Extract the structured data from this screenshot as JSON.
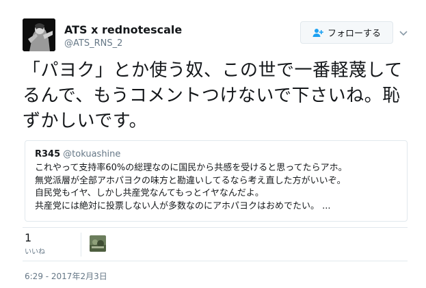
{
  "author": {
    "name": "ATS x rednotescale",
    "handle": "@ATS_RNS_2"
  },
  "follow_button": {
    "label": "フォローする",
    "icon": "add-user-icon"
  },
  "tweet_text": "「パヨク」とか使う奴、この世で一番軽蔑してるんで、もうコメントつけないで下さいね。恥ずかしいです。",
  "quoted_tweet": {
    "name": "R345",
    "handle": "@tokuashine",
    "lines": [
      "これやって支持率60%の総理なのに国民から共感を受けると思ってたらアホ。",
      "無党派層が全部アホパヨクの味方と勘違いしてるなら考え直した方がいいぞ。",
      "自民党もイヤ、しかし共産党なんてもっとイヤなんだよ。",
      "共産党には絶対に投票しない人が多数なのにアホパヨクはおめでたい。 ..."
    ]
  },
  "stats": {
    "likes_count": "1",
    "likes_label": "いいね"
  },
  "timestamp": "6:29 - 2017年2月3日",
  "colors": {
    "text_primary": "#14171a",
    "text_secondary": "#657786",
    "border": "#e1e8ed",
    "follow_icon": "#1da1f2"
  }
}
